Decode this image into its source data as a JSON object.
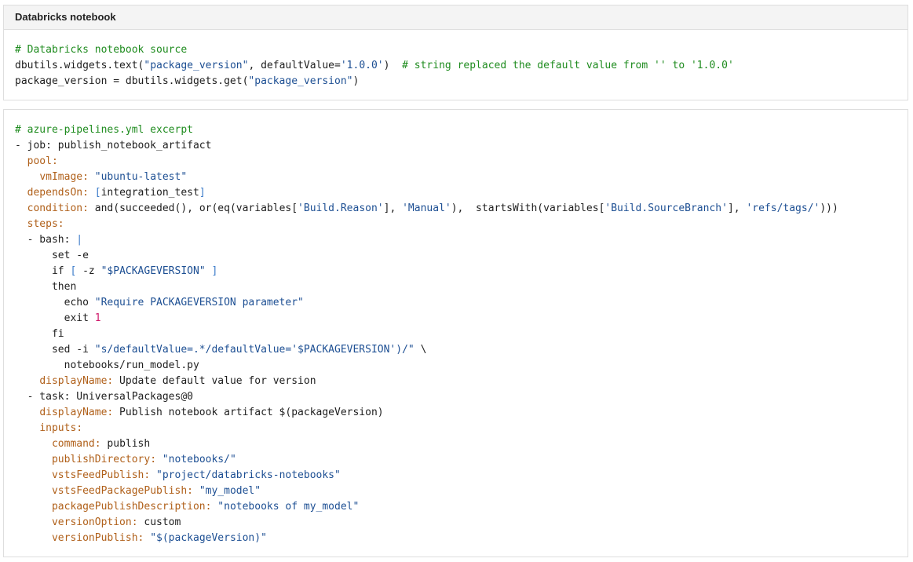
{
  "notebook_panel": {
    "title": "Databricks notebook",
    "lines": [
      [
        {
          "t": "# Databricks notebook source",
          "c": "c"
        }
      ],
      [
        {
          "t": "dbutils.widgets.text(",
          "c": "t"
        },
        {
          "t": "\"package_version\"",
          "c": "s"
        },
        {
          "t": ", defaultValue=",
          "c": "t"
        },
        {
          "t": "'1.0.0'",
          "c": "s"
        },
        {
          "t": ")  ",
          "c": "t"
        },
        {
          "t": "# string replaced the default value from '' to '1.0.0'",
          "c": "c"
        }
      ],
      [
        {
          "t": "package_version = dbutils.widgets.get(",
          "c": "t"
        },
        {
          "t": "\"package_version\"",
          "c": "s"
        },
        {
          "t": ")",
          "c": "t"
        }
      ]
    ]
  },
  "pipeline_panel": {
    "lines": [
      [
        {
          "t": "# azure-pipelines.yml excerpt",
          "c": "c"
        }
      ],
      [
        {
          "t": "- job: publish_notebook_artifact",
          "c": "t"
        }
      ],
      [
        {
          "t": "  ",
          "c": "t"
        },
        {
          "t": "pool:",
          "c": "k"
        }
      ],
      [
        {
          "t": "    ",
          "c": "t"
        },
        {
          "t": "vmImage:",
          "c": "k"
        },
        {
          "t": " ",
          "c": "t"
        },
        {
          "t": "\"ubuntu-latest\"",
          "c": "s"
        }
      ],
      [
        {
          "t": "  ",
          "c": "t"
        },
        {
          "t": "dependsOn:",
          "c": "k"
        },
        {
          "t": " ",
          "c": "t"
        },
        {
          "t": "[",
          "c": "p"
        },
        {
          "t": "integration_test",
          "c": "t"
        },
        {
          "t": "]",
          "c": "p"
        }
      ],
      [
        {
          "t": "  ",
          "c": "t"
        },
        {
          "t": "condition:",
          "c": "k"
        },
        {
          "t": " and(succeeded(), or(eq(variables[",
          "c": "t"
        },
        {
          "t": "'Build.Reason'",
          "c": "s"
        },
        {
          "t": "], ",
          "c": "t"
        },
        {
          "t": "'Manual'",
          "c": "s"
        },
        {
          "t": "),  startsWith(variables[",
          "c": "t"
        },
        {
          "t": "'Build.SourceBranch'",
          "c": "s"
        },
        {
          "t": "], ",
          "c": "t"
        },
        {
          "t": "'refs/tags/'",
          "c": "s"
        },
        {
          "t": ")))",
          "c": "t"
        }
      ],
      [
        {
          "t": "  ",
          "c": "t"
        },
        {
          "t": "steps:",
          "c": "k"
        }
      ],
      [
        {
          "t": "  - bash: ",
          "c": "t"
        },
        {
          "t": "|",
          "c": "p"
        }
      ],
      [
        {
          "t": "      set -e",
          "c": "t"
        }
      ],
      [
        {
          "t": "      if ",
          "c": "t"
        },
        {
          "t": "[",
          "c": "p"
        },
        {
          "t": " -z ",
          "c": "t"
        },
        {
          "t": "\"$PACKAGEVERSION\"",
          "c": "s"
        },
        {
          "t": " ",
          "c": "t"
        },
        {
          "t": "]",
          "c": "p"
        }
      ],
      [
        {
          "t": "      then",
          "c": "t"
        }
      ],
      [
        {
          "t": "        echo ",
          "c": "t"
        },
        {
          "t": "\"Require PACKAGEVERSION parameter\"",
          "c": "s"
        }
      ],
      [
        {
          "t": "        exit ",
          "c": "t"
        },
        {
          "t": "1",
          "c": "n"
        }
      ],
      [
        {
          "t": "      fi",
          "c": "t"
        }
      ],
      [
        {
          "t": "      sed -i ",
          "c": "t"
        },
        {
          "t": "\"s/defaultValue=.*/defaultValue='$PACKAGEVERSION')/\"",
          "c": "s"
        },
        {
          "t": " \\",
          "c": "t"
        }
      ],
      [
        {
          "t": "        notebooks/run_model.py",
          "c": "t"
        }
      ],
      [
        {
          "t": "    ",
          "c": "t"
        },
        {
          "t": "displayName:",
          "c": "k"
        },
        {
          "t": " Update default value for version",
          "c": "t"
        }
      ],
      [
        {
          "t": "  - task: UniversalPackages@0",
          "c": "t"
        }
      ],
      [
        {
          "t": "    ",
          "c": "t"
        },
        {
          "t": "displayName:",
          "c": "k"
        },
        {
          "t": " Publish notebook artifact $(packageVersion)",
          "c": "t"
        }
      ],
      [
        {
          "t": "    ",
          "c": "t"
        },
        {
          "t": "inputs:",
          "c": "k"
        }
      ],
      [
        {
          "t": "      ",
          "c": "t"
        },
        {
          "t": "command:",
          "c": "k"
        },
        {
          "t": " publish",
          "c": "t"
        }
      ],
      [
        {
          "t": "      ",
          "c": "t"
        },
        {
          "t": "publishDirectory:",
          "c": "k"
        },
        {
          "t": " ",
          "c": "t"
        },
        {
          "t": "\"notebooks/\"",
          "c": "s"
        }
      ],
      [
        {
          "t": "      ",
          "c": "t"
        },
        {
          "t": "vstsFeedPublish:",
          "c": "k"
        },
        {
          "t": " ",
          "c": "t"
        },
        {
          "t": "\"project/databricks-notebooks\"",
          "c": "s"
        }
      ],
      [
        {
          "t": "      ",
          "c": "t"
        },
        {
          "t": "vstsFeedPackagePublish:",
          "c": "k"
        },
        {
          "t": " ",
          "c": "t"
        },
        {
          "t": "\"my_model\"",
          "c": "s"
        }
      ],
      [
        {
          "t": "      ",
          "c": "t"
        },
        {
          "t": "packagePublishDescription:",
          "c": "k"
        },
        {
          "t": " ",
          "c": "t"
        },
        {
          "t": "\"notebooks of my_model\"",
          "c": "s"
        }
      ],
      [
        {
          "t": "      ",
          "c": "t"
        },
        {
          "t": "versionOption:",
          "c": "k"
        },
        {
          "t": " custom",
          "c": "t"
        }
      ],
      [
        {
          "t": "      ",
          "c": "t"
        },
        {
          "t": "versionPublish:",
          "c": "k"
        },
        {
          "t": " ",
          "c": "t"
        },
        {
          "t": "\"$(packageVersion)\"",
          "c": "s"
        }
      ]
    ]
  }
}
